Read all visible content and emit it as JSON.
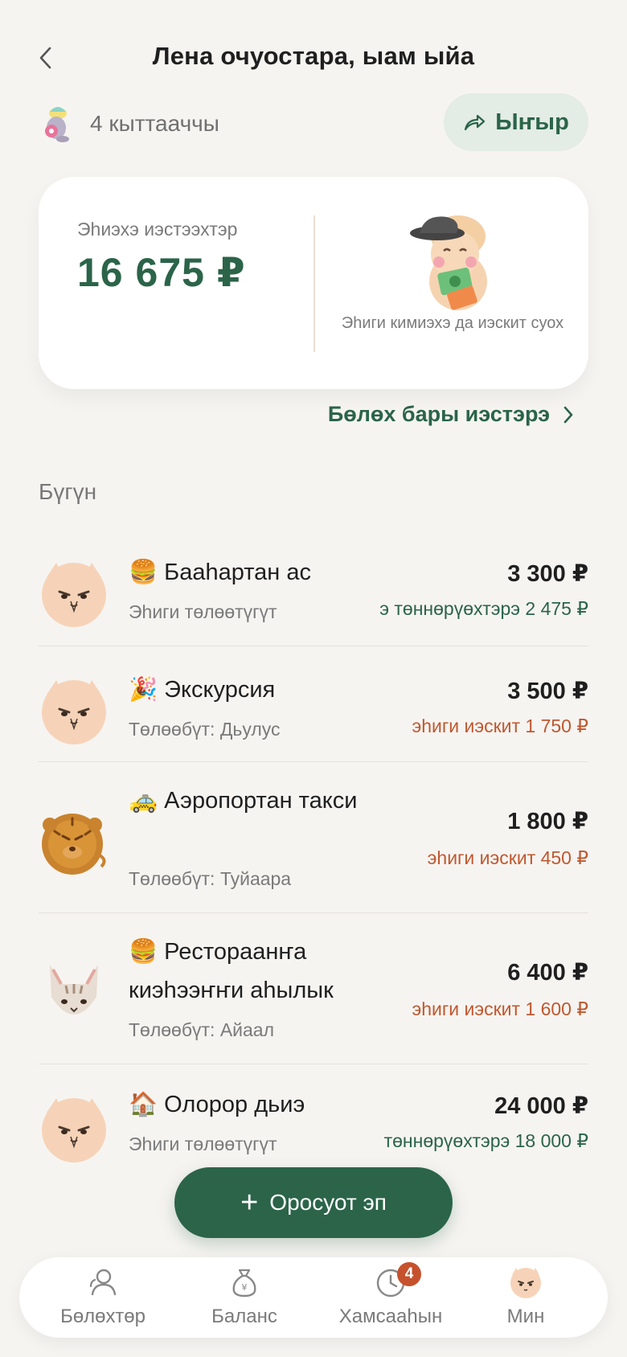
{
  "header": {
    "title": "Лена очуостара, ыам ыйа"
  },
  "members": {
    "count_label": "4 кыттааччы"
  },
  "share_button": {
    "label": "Ыҥыр"
  },
  "balance": {
    "label": "Эһиэхэ иэстээхтэр",
    "amount": "16 675 ₽",
    "caption": "Эһиги кимиэхэ да иэскит суох"
  },
  "details_link": {
    "label": "Бөлөх бары иэстэрэ"
  },
  "section": {
    "today_label": "Бүгүн"
  },
  "expenses": [
    {
      "emoji": "🍔",
      "title": "Бааһартан ас",
      "subtitle": "Эһиги төлөөтүгүт",
      "amount": "3 300 ₽",
      "share": "э төннөрүөхтэрэ 2 475 ₽",
      "share_type": "owed",
      "avatar": "cat-face-icon"
    },
    {
      "emoji": "🎉",
      "title": "Экскурсия",
      "subtitle": "Төлөөбүт: Дьулус",
      "amount": "3 500 ₽",
      "share": "эһиги иэскит 1 750 ₽",
      "share_type": "debt",
      "avatar": "cat-face-icon"
    },
    {
      "emoji": "🚕",
      "title": "Аэропортан такси",
      "subtitle": "Төлөөбүт: Туйаара",
      "amount": "1 800 ₽",
      "share": "эһиги иэскит 450 ₽",
      "share_type": "debt",
      "avatar": "tiger-face-icon"
    },
    {
      "emoji": "🍔",
      "title": "Рестораанҥа киэһээҥҥи аһылык",
      "subtitle": "Төлөөбүт: Айаал",
      "amount": "6 400 ₽",
      "share": "эһиги иэскит 1 600 ₽",
      "share_type": "debt",
      "avatar": "tabby-cat-icon"
    },
    {
      "emoji": "🏠",
      "title": "Олорор дьиэ",
      "subtitle": "Эһиги төлөөтүгүт",
      "amount": "24 000 ₽",
      "share": "төннөрүөхтэрэ 18 000 ₽",
      "share_type": "owed",
      "avatar": "cat-face-icon"
    }
  ],
  "add_button": {
    "label": "Оросуот эп",
    "icon": "plus-icon"
  },
  "tabbar": {
    "items": [
      {
        "label": "Бөлөхтөр",
        "icon": "people-icon"
      },
      {
        "label": "Баланс",
        "icon": "money-bag-icon"
      },
      {
        "label": "Хамсааһын",
        "icon": "clock-icon",
        "badge": "4"
      },
      {
        "label": "Мин",
        "icon": "profile-avatar-icon"
      }
    ]
  },
  "colors": {
    "accent": "#2b6449",
    "debt": "#c0582f",
    "background": "#f6f4f1"
  }
}
